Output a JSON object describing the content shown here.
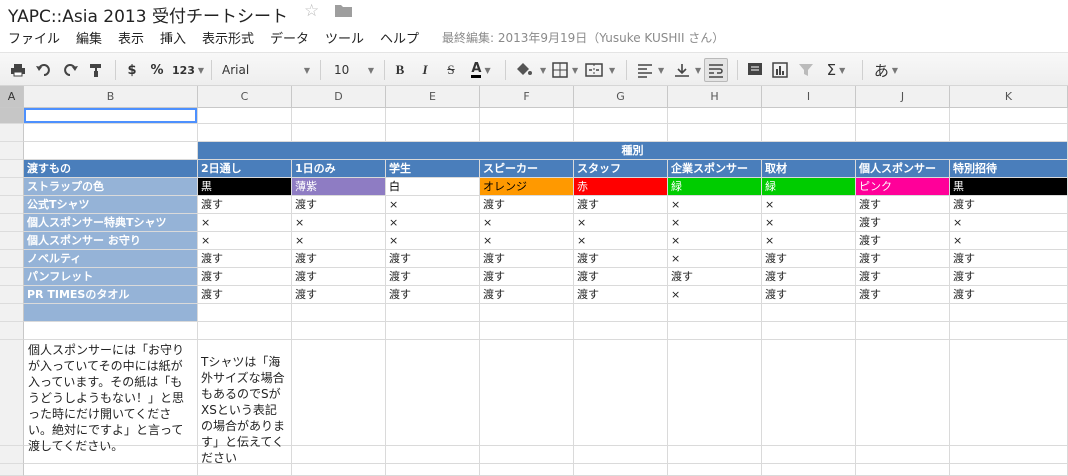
{
  "doc": {
    "title": "YAPC::Asia 2013 受付チートシート",
    "star_icon": "star-icon",
    "folder_icon": "folder-icon"
  },
  "menu": {
    "items": [
      "ファイル",
      "編集",
      "表示",
      "挿入",
      "表示形式",
      "データ",
      "ツール",
      "ヘルプ"
    ],
    "last_edit": "最終編集: 2013年9月19日（Yusuke KUSHII さん）"
  },
  "toolbar": {
    "zoom_format": "123",
    "currency": "$",
    "percent": "%",
    "font": "Arial",
    "font_size": "10",
    "bold": "B",
    "italic": "I",
    "strike": "S",
    "text_color": "A",
    "sigma": "Σ",
    "input_tool": "あ",
    "icons": [
      "print-icon",
      "undo-icon",
      "redo-icon",
      "paint-format-icon",
      "fill-color-icon",
      "borders-icon",
      "merge-icon",
      "align-left-icon",
      "valign-bottom-icon",
      "wrap-text-icon",
      "comment-icon",
      "chart-icon",
      "filter-icon",
      "functions-icon"
    ]
  },
  "columns": [
    "A",
    "B",
    "C",
    "D",
    "E",
    "F",
    "G",
    "H",
    "I",
    "J",
    "K"
  ],
  "table": {
    "group_header": "種別",
    "corner_label": "渡すもの",
    "categories": [
      "2日通し",
      "1日のみ",
      "学生",
      "スピーカー",
      "スタッフ",
      "企業スポンサー",
      "取材",
      "個人スポンサー",
      "特別招待"
    ],
    "strap_label": "ストラップの色",
    "strap_colors": [
      {
        "text": "黒",
        "bg": "#000000",
        "fg": "#ffffff"
      },
      {
        "text": "薄紫",
        "bg": "#8e7cc3",
        "fg": "#ffffff"
      },
      {
        "text": "白",
        "bg": "#ffffff",
        "fg": "#000000"
      },
      {
        "text": "オレンジ",
        "bg": "#ff9900",
        "fg": "#000000"
      },
      {
        "text": "赤",
        "bg": "#ff0000",
        "fg": "#ffffff"
      },
      {
        "text": "緑",
        "bg": "#00cc00",
        "fg": "#ffffff"
      },
      {
        "text": "緑",
        "bg": "#00cc00",
        "fg": "#ffffff"
      },
      {
        "text": "ピンク",
        "bg": "#ff0099",
        "fg": "#ffffff"
      },
      {
        "text": "黒",
        "bg": "#000000",
        "fg": "#ffffff"
      }
    ],
    "rows": [
      {
        "label": "公式Tシャツ",
        "values": [
          "渡す",
          "渡す",
          "×",
          "渡す",
          "渡す",
          "×",
          "×",
          "渡す",
          "渡す"
        ]
      },
      {
        "label": "個人スポンサー特典Tシャツ",
        "values": [
          "×",
          "×",
          "×",
          "×",
          "×",
          "×",
          "×",
          "渡す",
          "×"
        ]
      },
      {
        "label": "個人スポンサー お守り",
        "values": [
          "×",
          "×",
          "×",
          "×",
          "×",
          "×",
          "×",
          "渡す",
          "×"
        ]
      },
      {
        "label": "ノベルティ",
        "values": [
          "渡す",
          "渡す",
          "渡す",
          "渡す",
          "渡す",
          "×",
          "渡す",
          "渡す",
          "渡す"
        ]
      },
      {
        "label": "パンフレット",
        "values": [
          "渡す",
          "渡す",
          "渡す",
          "渡す",
          "渡す",
          "渡す",
          "渡す",
          "渡す",
          "渡す"
        ]
      },
      {
        "label": "PR TIMESのタオル",
        "values": [
          "渡す",
          "渡す",
          "渡す",
          "渡す",
          "渡す",
          "×",
          "渡す",
          "渡す",
          "渡す"
        ]
      }
    ]
  },
  "notes": {
    "b": "個人スポンサーには「お守りが入っていてその中には紙が入っています。その紙は「もうどうしようもない！」と思った時にだけ開いてください。絶対にですよ」と言って渡してください。",
    "c": "Tシャツは「海外サイズな場合もあるのでSがXSという表記の場合があります」と伝えてください"
  }
}
